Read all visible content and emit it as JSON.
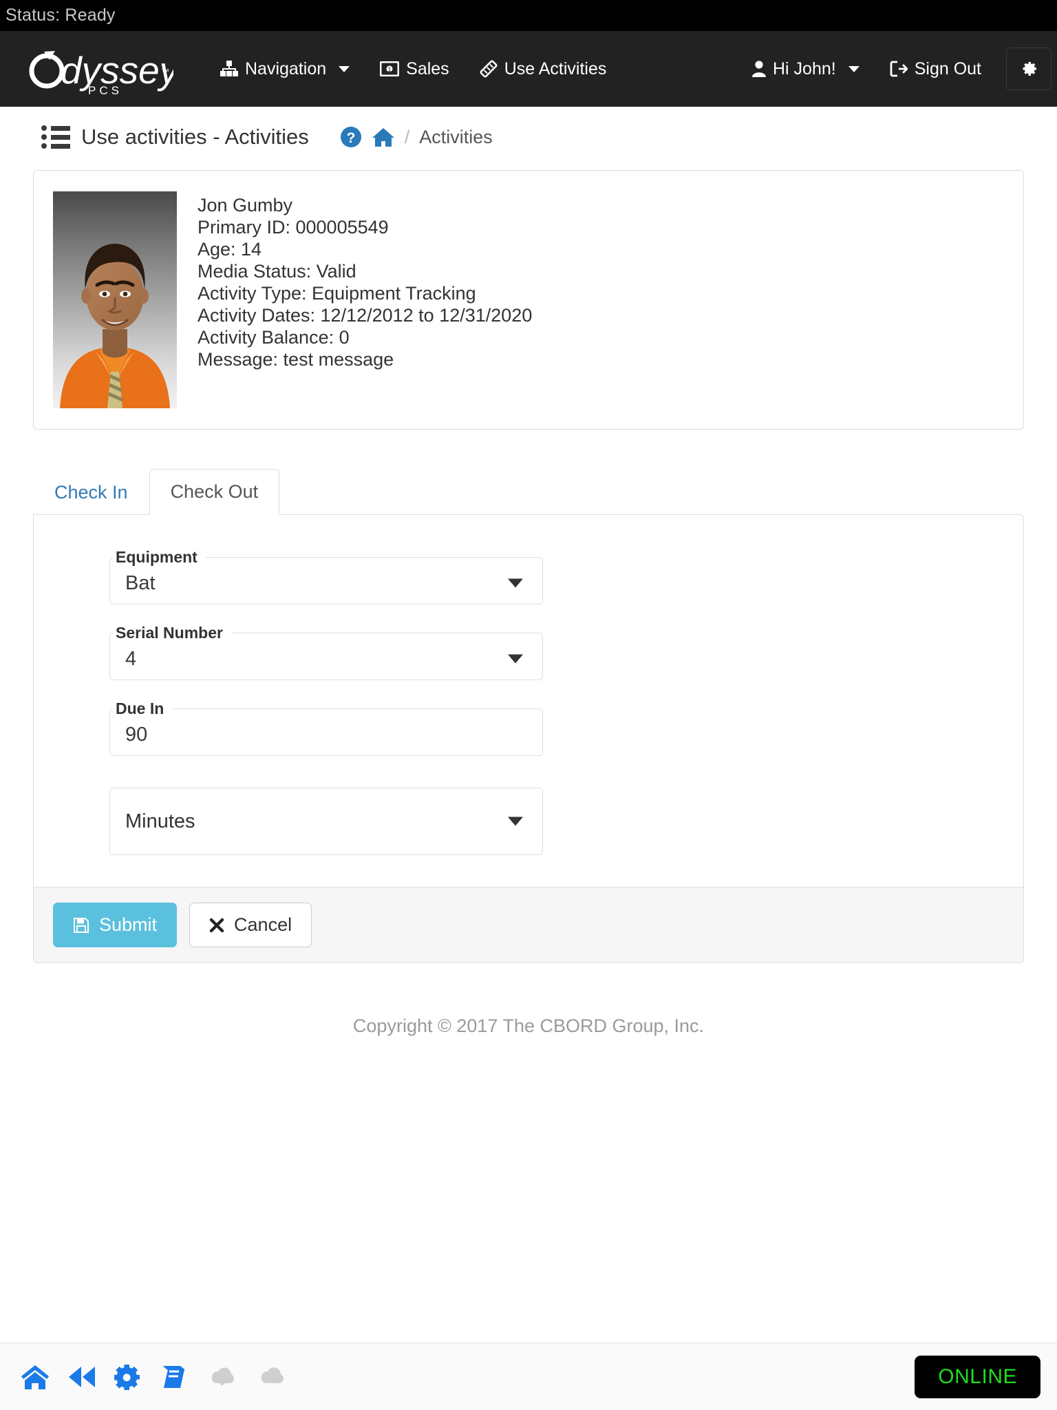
{
  "status_bar": {
    "text": "Status: Ready"
  },
  "navbar": {
    "brand": {
      "name": "Odyssey",
      "sub": "PCS",
      "tm": "™"
    },
    "items": [
      {
        "label": "Navigation",
        "icon": "sitemap-icon",
        "caret": true
      },
      {
        "label": "Sales",
        "icon": "money-bill-icon",
        "caret": false
      },
      {
        "label": "Use Activities",
        "icon": "ticket-icon",
        "caret": false
      }
    ],
    "right": [
      {
        "label": "Hi John!",
        "icon": "user-icon",
        "caret": true
      },
      {
        "label": "Sign Out",
        "icon": "sign-out-icon",
        "caret": false
      }
    ],
    "settings_icon": "gear-icon"
  },
  "page": {
    "title": "Use activities - Activities",
    "title_icon": "list-ul-icon",
    "help_icon": "question-circle-icon",
    "home_icon": "home-icon",
    "breadcrumb_separator": "/",
    "breadcrumb_current": "Activities"
  },
  "person": {
    "name": "Jon Gumby",
    "lines": [
      "Primary ID: 000005549",
      "Age: 14",
      "Media Status: Valid",
      "Activity Type: Equipment Tracking",
      "Activity Dates: 12/12/2012 to 12/31/2020",
      "Activity Balance: 0",
      "Message: test message"
    ]
  },
  "tabs": [
    {
      "label": "Check In",
      "active": false
    },
    {
      "label": "Check Out",
      "active": true
    }
  ],
  "form": {
    "equipment": {
      "legend": "Equipment",
      "value": "Bat",
      "type": "select"
    },
    "serial_number": {
      "legend": "Serial Number",
      "value": "4",
      "type": "select"
    },
    "due_in": {
      "legend": "Due In",
      "value": "90",
      "type": "text"
    },
    "unit": {
      "legend": "",
      "value": "Minutes",
      "type": "select"
    }
  },
  "buttons": {
    "submit": {
      "label": "Submit",
      "icon": "save-icon"
    },
    "cancel": {
      "label": "Cancel",
      "icon": "times-icon"
    }
  },
  "copyright": "Copyright © 2017 The CBORD Group, Inc.",
  "bottom_bar": {
    "icons": [
      {
        "name": "home-icon",
        "enabled": true
      },
      {
        "name": "fast-backward-icon",
        "enabled": true
      },
      {
        "name": "gear-icon",
        "enabled": true
      },
      {
        "name": "book-icon",
        "enabled": true
      },
      {
        "name": "cloud-download-icon",
        "enabled": false
      },
      {
        "name": "cloud-upload-icon",
        "enabled": false
      }
    ],
    "connection_status": "ONLINE"
  },
  "colors": {
    "navbar_bg": "#222222",
    "status_bg": "#000000",
    "accent_blue": "#337ab7",
    "icon_blue": "#1a7ae8",
    "primary_btn": "#5bc0de",
    "online_green": "#1fdd1f",
    "disabled_gray": "#cccccc"
  }
}
